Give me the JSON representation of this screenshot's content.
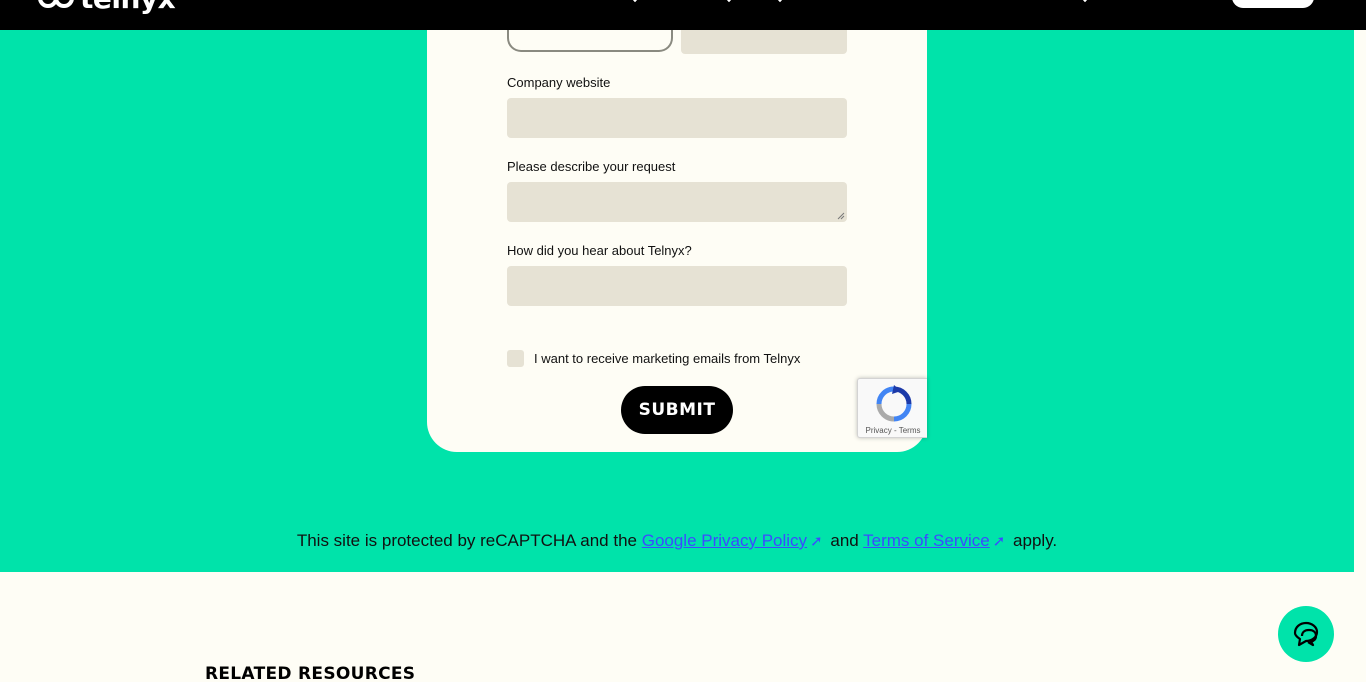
{
  "header": {
    "logo_text": "telnyx"
  },
  "form": {
    "company_website_label": "Company website",
    "company_website_value": "",
    "request_label": "Please describe your request",
    "request_value": "",
    "hear_about_label": "How did you hear about Telnyx?",
    "hear_about_value": "",
    "marketing_checkbox_label": "I want to receive marketing emails from Telnyx",
    "marketing_checked": false,
    "submit_label": "SUBMIT"
  },
  "recaptcha": {
    "privacy": "Privacy",
    "separator": " - ",
    "terms": "Terms"
  },
  "notice": {
    "prefix": "This site is protected by reCAPTCHA and the ",
    "privacy_link": "Google Privacy Policy",
    "conjunction": " and ",
    "terms_link": "Terms of Service",
    "suffix": " apply."
  },
  "related": {
    "heading": "RELATED RESOURCES"
  },
  "colors": {
    "brand_green": "#00e3aa",
    "field_bg": "#e6e2d4",
    "card_bg": "#fefdf5",
    "link": "#3b4bff",
    "black": "#000000"
  },
  "icons": {
    "chat": "chat-bubbles-icon",
    "external": "external-link-arrow-icon",
    "recaptcha": "recaptcha-logo-icon"
  }
}
